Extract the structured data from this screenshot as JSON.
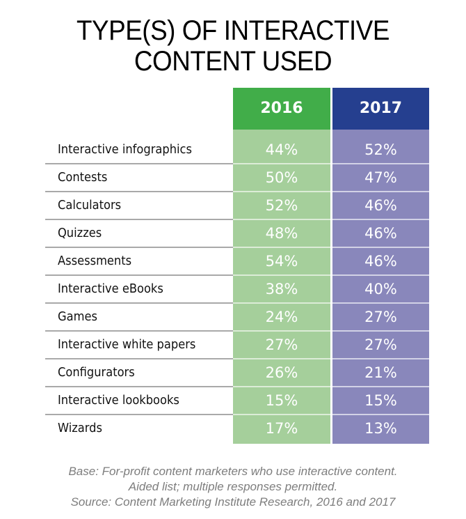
{
  "title": {
    "line1": "TYPE(S) OF INTERACTIVE",
    "line2": "CONTENT USED"
  },
  "colors": {
    "header_2016": "#41ad49",
    "header_2017": "#253f8f",
    "cell_2016": "#a5cf9b",
    "cell_2017": "#8987bb"
  },
  "chart_data": {
    "type": "table",
    "title": "TYPE(S) OF INTERACTIVE CONTENT USED",
    "columns": [
      "2016",
      "2017"
    ],
    "categories": [
      "Interactive infographics",
      "Contests",
      "Calculators",
      "Quizzes",
      "Assessments",
      "Interactive eBooks",
      "Games",
      "Interactive white papers",
      "Configurators",
      "Interactive lookbooks",
      "Wizards"
    ],
    "series": [
      {
        "name": "2016",
        "values": [
          44,
          50,
          52,
          48,
          54,
          38,
          24,
          27,
          26,
          15,
          17
        ]
      },
      {
        "name": "2017",
        "values": [
          52,
          47,
          46,
          46,
          46,
          40,
          27,
          27,
          21,
          15,
          13
        ]
      }
    ],
    "unit": "%",
    "footnotes": [
      "Base: For-profit content marketers who use interactive content.",
      "Aided list; multiple responses permitted.",
      "Source: Content Marketing Institute Research, 2016 and 2017"
    ]
  },
  "footer": {
    "line1": "Base: For-profit content marketers who use interactive content.",
    "line2": "Aided list; multiple responses permitted.",
    "line3": "Source: Content Marketing Institute Research, 2016 and 2017"
  }
}
